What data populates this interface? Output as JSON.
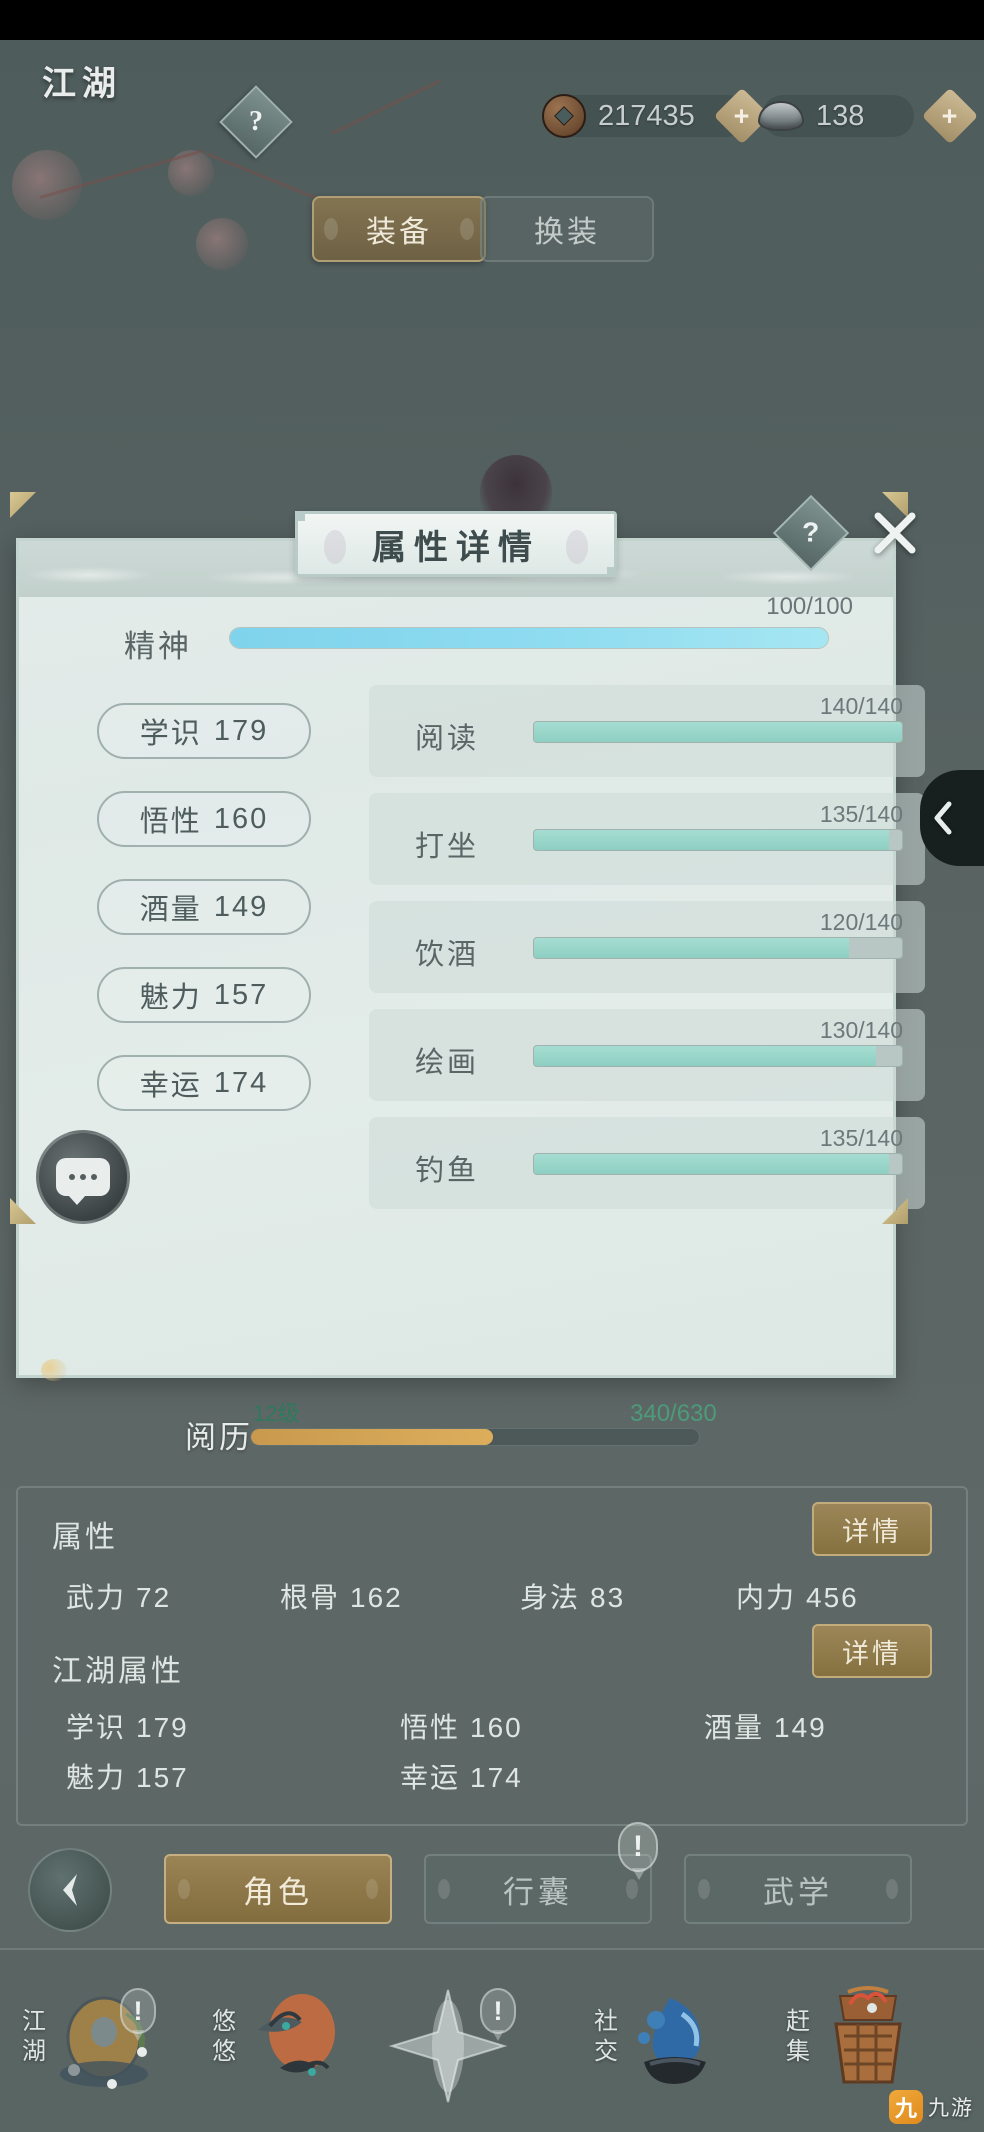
{
  "header": {
    "brand": "江湖",
    "help_icon": "?",
    "currencies": [
      {
        "icon": "copper-coin-icon",
        "value": "217435",
        "plus": "+"
      },
      {
        "icon": "silver-ingot-icon",
        "value": "138",
        "plus": "+"
      }
    ]
  },
  "equipment_tabs": [
    {
      "label": "装备",
      "active": true
    },
    {
      "label": "换装",
      "active": false
    }
  ],
  "dialog": {
    "title": "属性详情",
    "help_icon": "?",
    "close_icon": "×",
    "spirit": {
      "label": "精神",
      "value": "100/100",
      "current": 100,
      "max": 100
    },
    "attribute_pills": [
      {
        "label": "学识",
        "value": "179"
      },
      {
        "label": "悟性",
        "value": "160"
      },
      {
        "label": "酒量",
        "value": "149"
      },
      {
        "label": "魅力",
        "value": "157"
      },
      {
        "label": "幸运",
        "value": "174"
      }
    ],
    "skills": [
      {
        "name": "阅读",
        "value": "140/140",
        "current": 140,
        "max": 140
      },
      {
        "name": "打坐",
        "value": "135/140",
        "current": 135,
        "max": 140
      },
      {
        "name": "饮酒",
        "value": "120/140",
        "current": 120,
        "max": 140
      },
      {
        "name": "绘画",
        "value": "130/140",
        "current": 130,
        "max": 140
      },
      {
        "name": "钓鱼",
        "value": "135/140",
        "current": 135,
        "max": 140
      }
    ]
  },
  "experience": {
    "label": "阅历",
    "level": "12级",
    "value": "340/630",
    "current": 340,
    "max": 630
  },
  "attribute_panel": {
    "basic": {
      "heading": "属性",
      "detail_label": "详情",
      "stats": [
        {
          "label": "武力",
          "value": "72"
        },
        {
          "label": "根骨",
          "value": "162"
        },
        {
          "label": "身法",
          "value": "83"
        },
        {
          "label": "内力",
          "value": "456"
        }
      ]
    },
    "jianghu": {
      "heading": "江湖属性",
      "detail_label": "详情",
      "stats": [
        {
          "label": "学识",
          "value": "179"
        },
        {
          "label": "悟性",
          "value": "160"
        },
        {
          "label": "酒量",
          "value": "149"
        },
        {
          "label": "魅力",
          "value": "157"
        },
        {
          "label": "幸运",
          "value": "174"
        }
      ]
    }
  },
  "bottom_tabs": {
    "back_icon": "chevron-left-icon",
    "items": [
      {
        "label": "角色",
        "active": true,
        "badge": ""
      },
      {
        "label": "行囊",
        "active": false,
        "badge": "!"
      },
      {
        "label": "武学",
        "active": false,
        "badge": ""
      }
    ]
  },
  "navbar": {
    "items": [
      {
        "label": "江湖",
        "icon": "pond-icon",
        "badge": "!"
      },
      {
        "label": "悠悠",
        "icon": "swallow-icon",
        "badge": ""
      },
      {
        "label": "",
        "icon": "star-burst-icon",
        "badge": "!"
      },
      {
        "label": "社交",
        "icon": "water-icon",
        "badge": ""
      },
      {
        "label": "赶集",
        "icon": "basket-icon",
        "badge": ""
      }
    ]
  },
  "watermark": {
    "logo": "九",
    "text": "九游"
  },
  "colors": {
    "accent_gold": "#9c8659",
    "spirit_bar": "#8fdcf0",
    "skill_bar": "#8ecfc2",
    "exp_bar": "#dcae5c",
    "dialog_bg": "#e4ecea",
    "page_bg": "#5a6563"
  }
}
